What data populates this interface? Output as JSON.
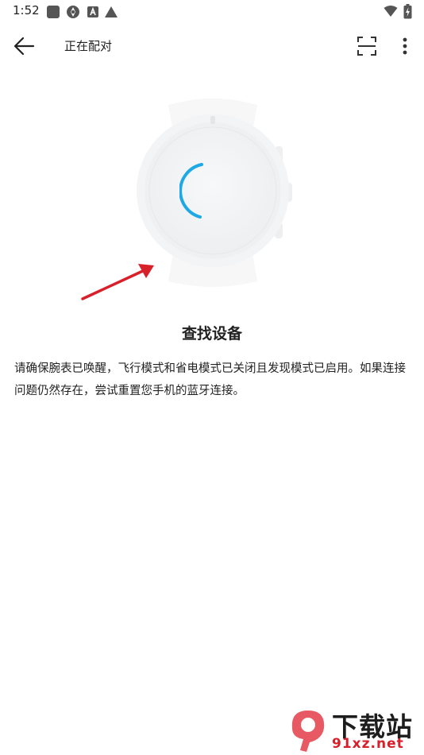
{
  "status_bar": {
    "time": "1:52",
    "icons": [
      "notification-square-icon",
      "aperture-icon",
      "app-a-icon",
      "triangle-alert-icon",
      "wifi-icon",
      "battery-charging-icon"
    ]
  },
  "app_bar": {
    "title": "正在配对",
    "back_icon": "arrow-left-icon",
    "scan_icon": "scan-frame-icon",
    "more_icon": "more-vertical-icon"
  },
  "content": {
    "heading": "查找设备",
    "description": "请确保腕表已唤醒，飞行模式和省电模式已关闭且发现模式已启用。如果连接问题仍然存在，尝试重置您手机的蓝牙连接。"
  },
  "watermark": {
    "logo_text": "下载站",
    "url_text": "91xz.net"
  },
  "colors": {
    "spinner": "#1ea8e6",
    "annotation_arrow": "#d8202b",
    "watermark_red": "#d8202b"
  }
}
